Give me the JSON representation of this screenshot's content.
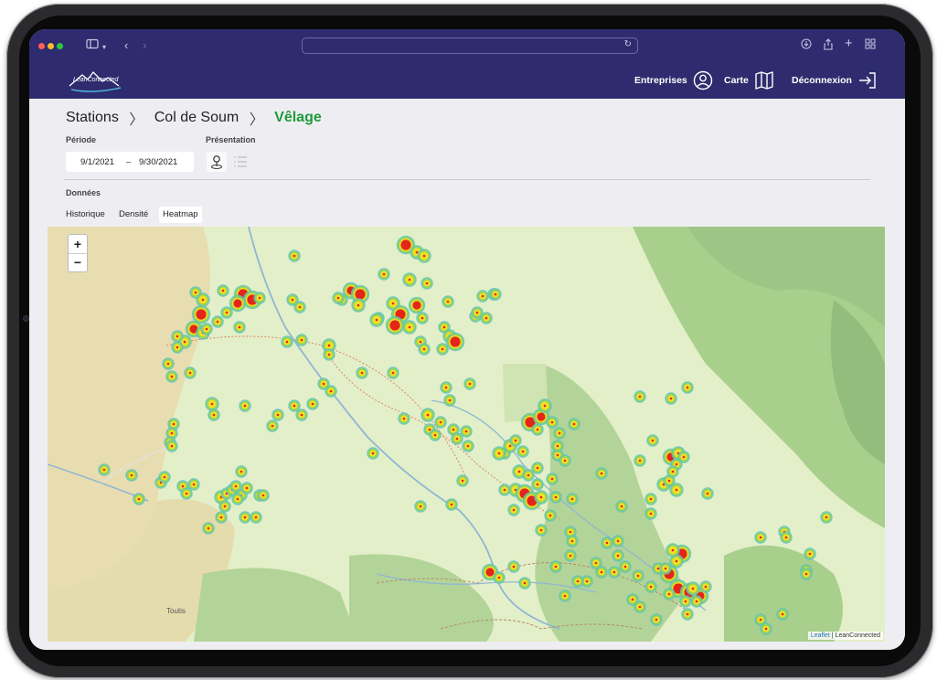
{
  "header": {
    "logo_text": "LeanConnected",
    "nav": [
      {
        "label": "Entreprises",
        "icon": "user-circle-icon"
      },
      {
        "label": "Carte",
        "icon": "map-icon"
      },
      {
        "label": "Déconnexion",
        "icon": "logout-icon"
      }
    ]
  },
  "breadcrumb": {
    "items": [
      "Stations",
      "Col de Soum"
    ],
    "current": "Vêlage",
    "separator": "〉"
  },
  "filters": {
    "period_label": "Période",
    "date_start": "9/1/2021",
    "date_sep": "–",
    "date_end": "9/30/2021",
    "presentation_label": "Présentation"
  },
  "data_section": {
    "label": "Données",
    "tabs": [
      "Historique",
      "Densité",
      "Heatmap"
    ],
    "active_tab": "Heatmap"
  },
  "map": {
    "zoom_in": "+",
    "zoom_out": "−",
    "attribution_link": "Leaflet",
    "attribution_sep": " | ",
    "attribution_text": "LeanConnected",
    "place_label": "Toutis",
    "colors": {
      "base": "#e3efc8",
      "forest": "#a9cf8d",
      "forest_dark": "#9ec585",
      "farmland": "#e8ddb0",
      "stream": "#8fb6d6",
      "path": "#d9876a",
      "heat_low": "#5fc3b6",
      "heat_mid": "#9bd44c",
      "heat_high": "#f1e027",
      "heat_max": "#e4251a"
    }
  },
  "colors": {
    "header_bg": "#2e2c6e",
    "accent_green": "#1f9a3a"
  }
}
